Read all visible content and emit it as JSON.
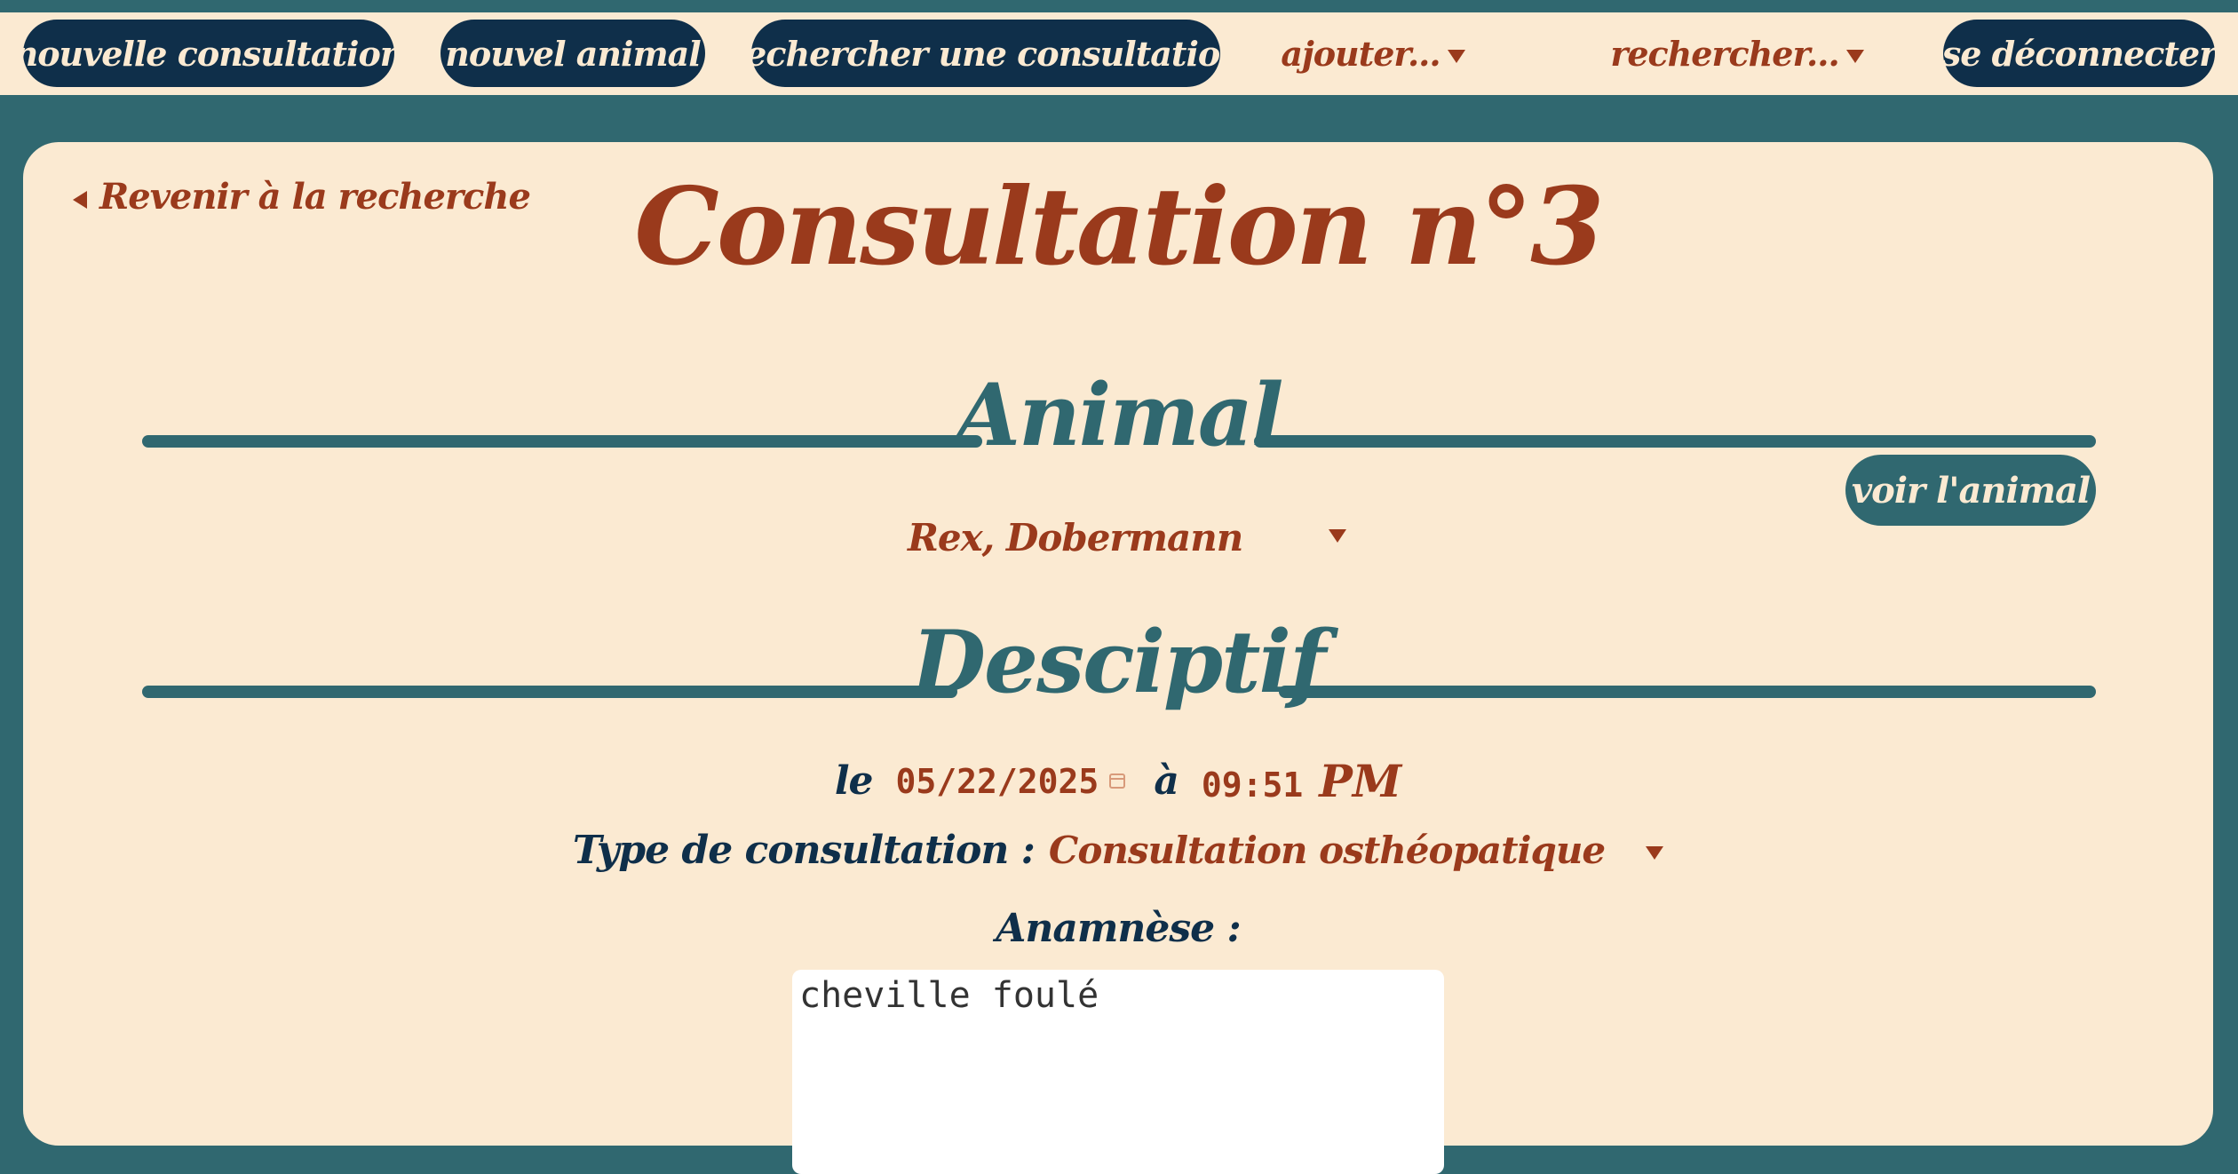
{
  "nav": {
    "new_consultation": "nouvelle consultation",
    "new_animal": "nouvel animal",
    "search_consultation": "rechercher une consultation",
    "add_menu": "ajouter...",
    "search_menu": "rechercher...",
    "logout": "se déconnecter"
  },
  "page": {
    "back_link": "Revenir à la recherche",
    "title": "Consultation n°3"
  },
  "animal_section": {
    "heading": "Animal",
    "view_button": "voir l'animal",
    "selected_animal": "Rex, Dobermann"
  },
  "description_section": {
    "heading": "Desciptif",
    "date_label": "le",
    "date_value": "05/22/2025",
    "time_label": "à",
    "time_value": "09:51",
    "time_ampm": "PM",
    "type_label": "Type de consultation :",
    "type_value": "Consultation osthéopatique",
    "anamnesis_label": "Anamnèse :",
    "anamnesis_value": "cheville foulé"
  },
  "colors": {
    "teal": "#306870",
    "navy": "#0f2f4a",
    "rust": "#9a3a1c",
    "cream": "#fbead2"
  }
}
